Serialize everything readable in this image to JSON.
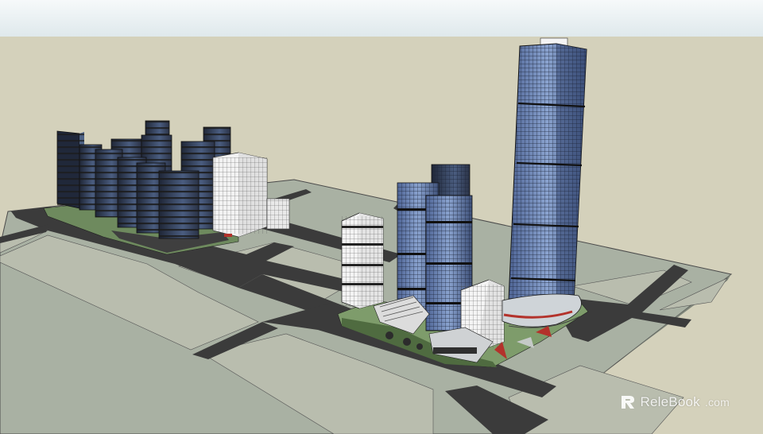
{
  "watermark": {
    "name": "ReleBook",
    "tld": ".com"
  },
  "colors": {
    "sky_top": "#f4f7f8",
    "sky_bottom": "#e2ecef",
    "ground": "#d4d1bb",
    "base_slab": "#a9b1a3",
    "lot": "#b8bcad",
    "road": "#3a3a3a",
    "glass_blue": "#6c86b5",
    "glass_dark": "#2a3447",
    "white_tower": "#f1f1f1",
    "grass": "#5c7f4d",
    "accent_red": "#b3322b"
  }
}
